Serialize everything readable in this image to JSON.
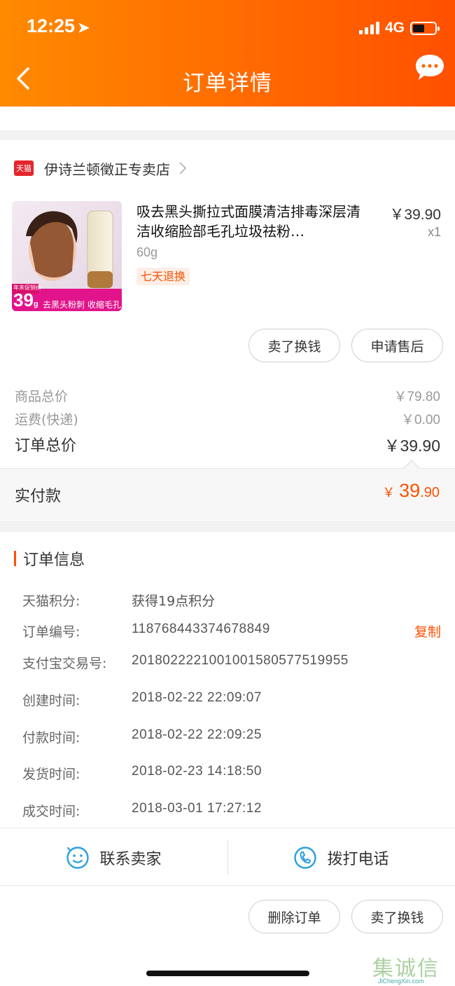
{
  "status_bar": {
    "time": "12:25",
    "network": "4G"
  },
  "header": {
    "title": "订单详情"
  },
  "store": {
    "badge": "天猫",
    "name": "伊诗兰顿徵正专卖店"
  },
  "product": {
    "title": "吸去黑头撕拉式面膜清洁排毒深层清洁收缩脸部毛孔垃圾祛粉…",
    "price": "￥39.90",
    "quantity": "x1",
    "sku": "60g",
    "tag": "七天退换",
    "image_text": {
      "price": "39",
      "unit": "g",
      "caption": "去黑头粉刺 收缩毛孔",
      "promo": "年末促销价"
    },
    "accent": "#ff5000"
  },
  "product_actions": {
    "sell_label": "卖了换钱",
    "after_sale_label": "申请售后"
  },
  "summary": {
    "goods_total_label": "商品总价",
    "goods_total": "￥79.80",
    "shipping_label": "运费(快递)",
    "shipping": "￥0.00",
    "order_total_label": "订单总价",
    "order_total": "￥39.90"
  },
  "paid": {
    "label": "实付款",
    "currency": "￥",
    "integer": "39",
    "decimal": ".90"
  },
  "order_info": {
    "title": "订单信息",
    "points_label": "天猫积分:",
    "points_value": "获得19点积分",
    "order_no_label": "订单编号:",
    "order_no": "118768443374678849",
    "copy_label": "复制",
    "alipay_label": "支付宝交易号:",
    "alipay_no": "2018022221001001580577519955",
    "created_label": "创建时间:",
    "created": "2018-02-22 22:09:07",
    "paid_label": "付款时间:",
    "paid": "2018-02-22 22:09:25",
    "shipped_label": "发货时间:",
    "shipped": "2018-02-23 14:18:50",
    "closed_label": "成交时间:",
    "closed": "2018-03-01 17:27:12"
  },
  "contact": {
    "seller_label": "联系卖家",
    "call_label": "拨打电话"
  },
  "bottom_actions": {
    "delete_label": "删除订单",
    "sell_label": "卖了换钱"
  },
  "watermark": {
    "big": "集诚信",
    "small": "JiChengXin.com"
  }
}
